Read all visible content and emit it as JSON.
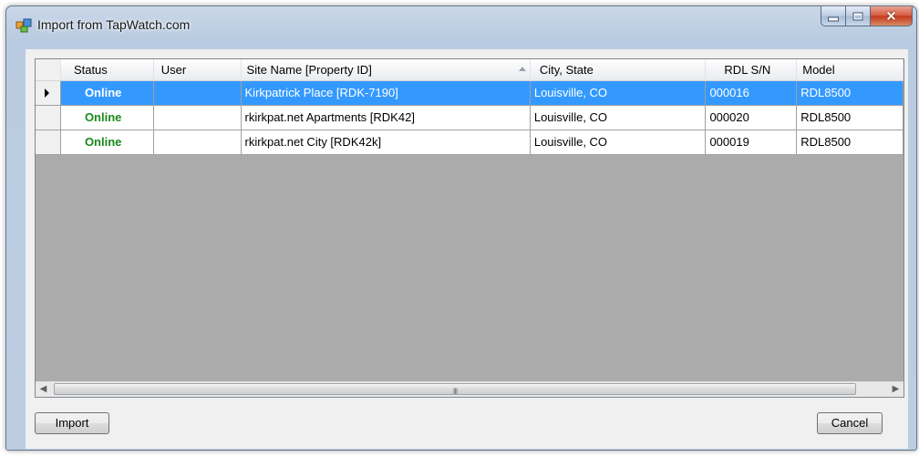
{
  "window": {
    "title": "Import from TapWatch.com"
  },
  "grid": {
    "columns": [
      "Status",
      "User",
      "Site Name [Property ID]",
      "City, State",
      "RDL S/N",
      "Model"
    ],
    "sorted_column_index": 2,
    "rows": [
      {
        "status": "Online",
        "user": "",
        "site": "Kirkpatrick Place [RDK-7190]",
        "city": "Louisville, CO",
        "sn": "000016",
        "model": "RDL8500",
        "selected": true
      },
      {
        "status": "Online",
        "user": "",
        "site": "rkirkpat.net Apartments [RDK42]",
        "city": "Louisville, CO",
        "sn": "000020",
        "model": "RDL8500",
        "selected": false
      },
      {
        "status": "Online",
        "user": "",
        "site": "rkirkpat.net City [RDK42k]",
        "city": "Louisville, CO",
        "sn": "000019",
        "model": "RDL8500",
        "selected": false
      }
    ],
    "scrollbar": {
      "grip": "III"
    }
  },
  "buttons": {
    "import": "Import",
    "cancel": "Cancel"
  },
  "icons": {
    "title": "app-icon",
    "minimize": "minimize-icon",
    "maximize": "maximize-icon",
    "close": "close-icon"
  },
  "colors": {
    "selection": "#3399ff",
    "online": "#1a8a1a",
    "grid_bg": "#ababab"
  }
}
